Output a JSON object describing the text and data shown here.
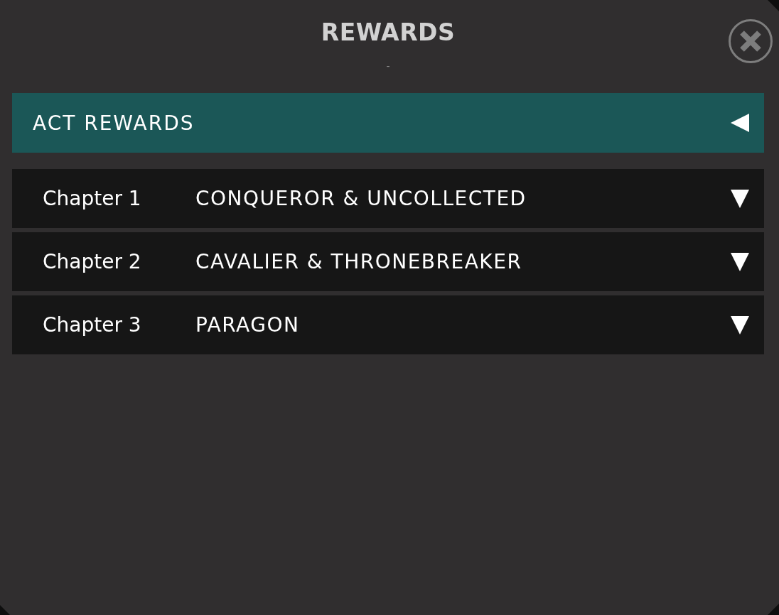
{
  "title": "REWARDS",
  "subtitle": "-",
  "sections": [
    {
      "label": "ACT REWARDS",
      "expanded": true,
      "chapters": [
        {
          "label": "Chapter 1",
          "title": "CONQUEROR & UNCOLLECTED",
          "expanded": false
        },
        {
          "label": "Chapter 2",
          "title": "CAVALIER & THRONEBREAKER",
          "expanded": false
        },
        {
          "label": "Chapter 3",
          "title": "PARAGON",
          "expanded": false
        }
      ]
    }
  ]
}
